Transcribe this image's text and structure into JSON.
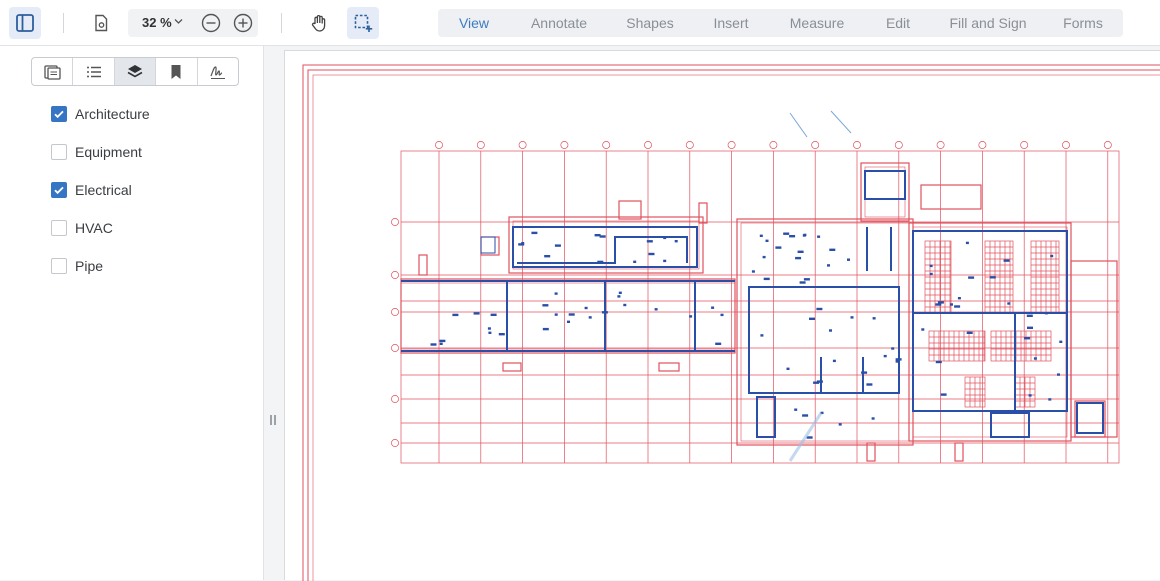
{
  "toolbar": {
    "zoom_value": "32 %",
    "icons": [
      "sidebar-toggle-icon",
      "document-settings-icon",
      "chevron-down-icon",
      "zoom-out-icon",
      "zoom-in-icon",
      "pan-hand-icon",
      "area-select-icon"
    ],
    "tabs": [
      "View",
      "Annotate",
      "Shapes",
      "Insert",
      "Measure",
      "Edit",
      "Fill and Sign",
      "Forms"
    ],
    "active_tab": "View"
  },
  "sidebar": {
    "panel_tabs": [
      "thumbnails-icon",
      "outline-icon",
      "layers-icon",
      "bookmark-icon",
      "signature-icon"
    ],
    "active_panel": "layers-icon",
    "layers": [
      {
        "label": "Architecture",
        "checked": true
      },
      {
        "label": "Equipment",
        "checked": false
      },
      {
        "label": "Electrical",
        "checked": true
      },
      {
        "label": "HVAC",
        "checked": false
      },
      {
        "label": "Pipe",
        "checked": false
      }
    ]
  },
  "colors": {
    "accent": "#3575c4",
    "architecture_layer": "#e0505e",
    "electrical_layer": "#2a4fa8"
  }
}
